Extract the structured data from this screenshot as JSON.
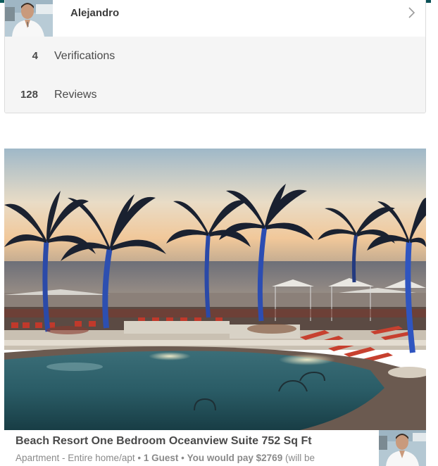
{
  "host": {
    "name": "Alejandro",
    "stats": [
      {
        "count": "4",
        "label": "Verifications"
      },
      {
        "count": "128",
        "label": "Reviews"
      }
    ]
  },
  "listing": {
    "title": "Beach Resort One Bedroom Oceanview Suite 752 Sq Ft",
    "type": "Apartment - Entire home/apt",
    "separator": "•",
    "guests": "1 Guest",
    "price_text": "You would pay $2769",
    "price_note": "(will be"
  },
  "icons": {
    "chevron": "chevron-right-icon",
    "avatar": "host-avatar",
    "photo": "listing-photo"
  },
  "colors": {
    "accent_teal": "#0f6a6a",
    "text_dark": "#4a4a4a",
    "text_muted": "#8a8a8a",
    "stats_bg": "#f5f5f5"
  }
}
